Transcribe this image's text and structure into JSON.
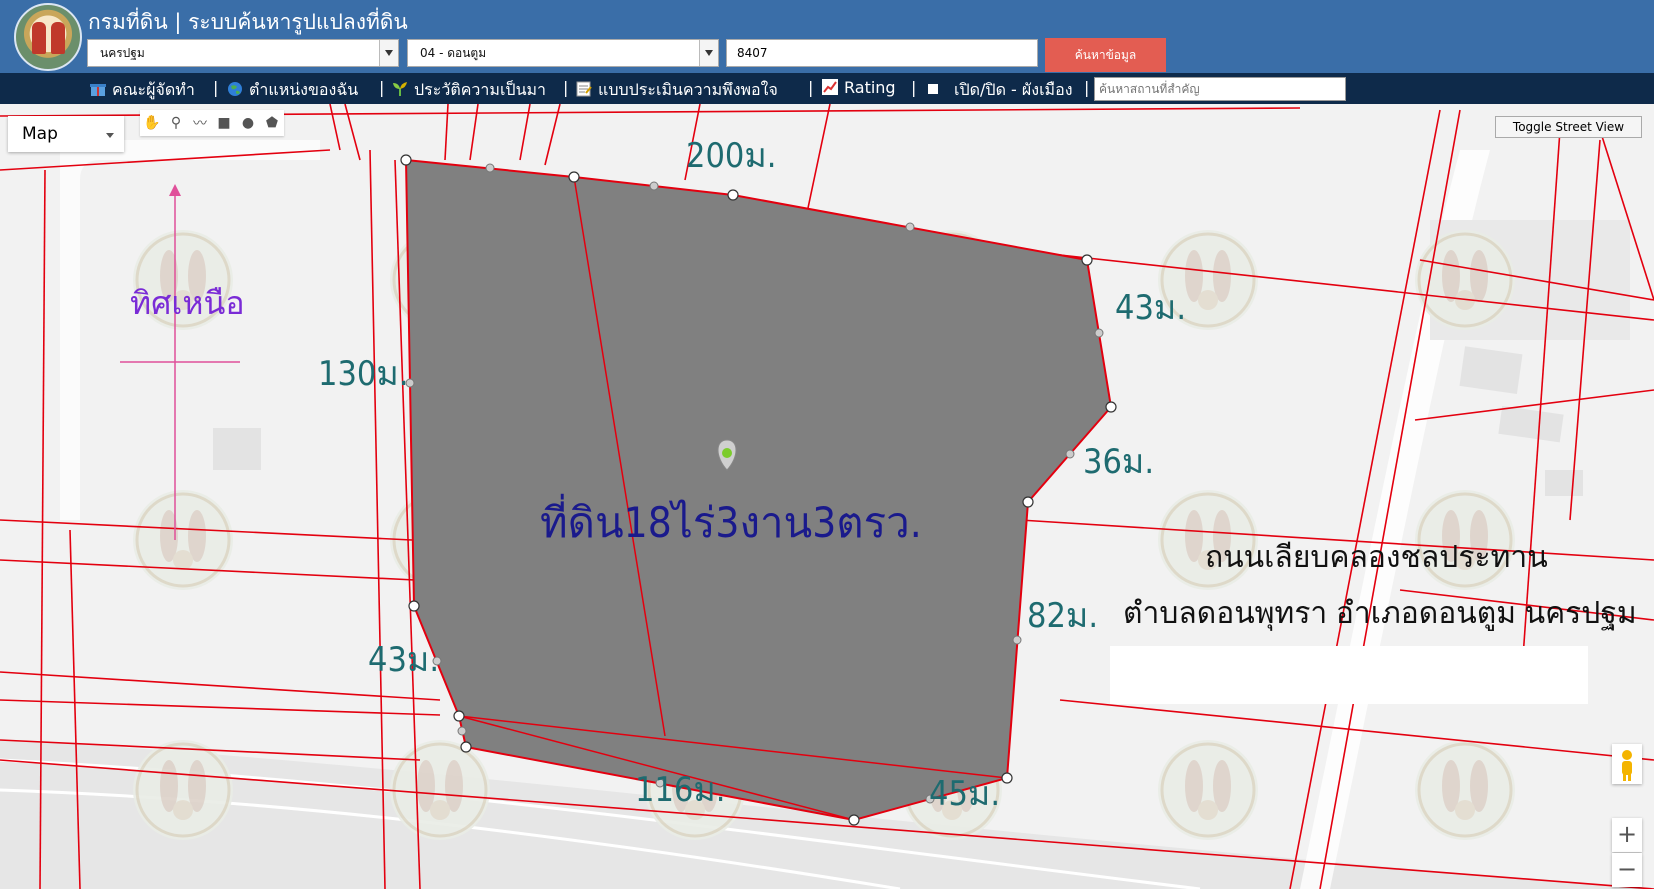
{
  "header": {
    "title": "กรมที่ดิน | ระบบค้นหารูปแปลงที่ดิน",
    "province_select": "นครปฐม",
    "district_select": "04 - ดอนตูม",
    "parcel_number": "8407",
    "search_button": "ค้นหาข้อมูล"
  },
  "menu": {
    "items": [
      {
        "label": "คณะผู้จัดทำ",
        "icon": "gift-icon"
      },
      {
        "label": "ตำแหน่งของฉัน",
        "icon": "globe-icon"
      },
      {
        "label": "ประวัติความเป็นมา",
        "icon": "sprout-icon"
      },
      {
        "label": "แบบประเมินความพึงพอใจ",
        "icon": "form-icon"
      },
      {
        "label": "Rating",
        "icon": "chart-icon"
      },
      {
        "label": "เปิด/ปิด - ผังเมือง",
        "icon": "checkbox-icon"
      }
    ],
    "place_search_placeholder": "ค้นหาสถานที่สำคัญ"
  },
  "map": {
    "type_label": "Map",
    "toggle_street_view": "Toggle Street View",
    "zoom_in": "+",
    "zoom_out": "−",
    "north_label": "ทิศเหนือ",
    "area_label": "ที่ดิน18ไร่3งาน3ตรว.",
    "road_label": "ถนนเลียบคลองชลประทาน",
    "location_label": "ตำบลดอนพุทรา อำเภอดอนตูม นครปฐม",
    "dimensions": [
      "200ม.",
      "43ม.",
      "130ม.",
      "36ม.",
      "82ม.",
      "43ม.",
      "116ม.",
      "45ม."
    ]
  },
  "colors": {
    "header_bg": "#3a6ea8",
    "menubar_bg": "#0e2a4a",
    "search_button": "#e35d52",
    "parcel_line": "#e3000f",
    "polygon_fill": "#808080",
    "dimension_text": "#1e6b70",
    "area_text": "#1a1a8c",
    "north_text": "#7a2bd6",
    "north_arrow": "#e0509a"
  }
}
